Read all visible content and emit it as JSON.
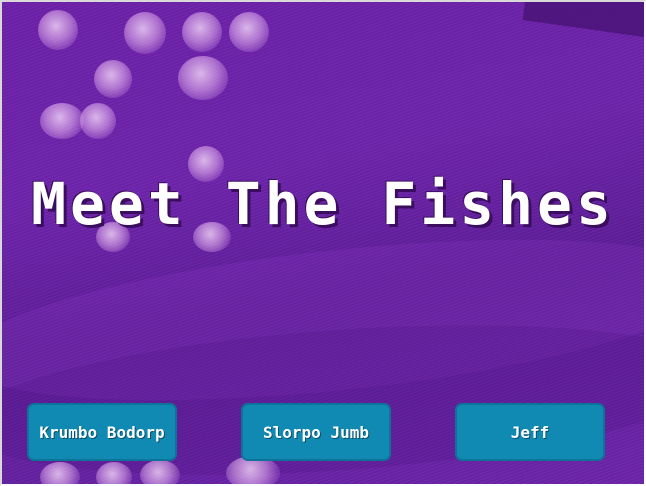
{
  "screen": {
    "title": "Meet The Fishes",
    "colors": {
      "background": "#6a1fa6",
      "button": "#118ab3",
      "title_text": "#ffffff"
    }
  },
  "fish_buttons": [
    {
      "label": "Krumbo Bodorp"
    },
    {
      "label": "Slorpo Jumb"
    },
    {
      "label": "Jeff"
    }
  ]
}
